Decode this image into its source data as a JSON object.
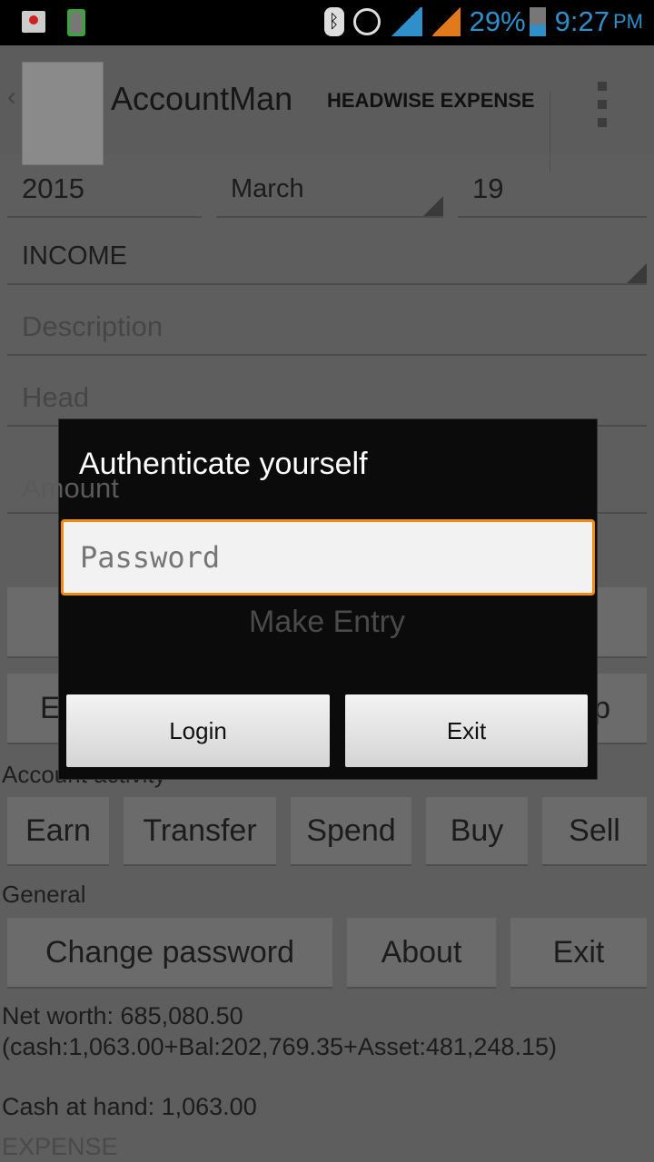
{
  "status_bar": {
    "battery": "29%",
    "time": "9:27",
    "ampm": "PM",
    "accent": "#2f8fc9"
  },
  "action_bar": {
    "title": "AccountMan",
    "action": "HEADWISE EXPENSE"
  },
  "form": {
    "year": "2015",
    "month": "March",
    "day": "19",
    "type": "INCOME",
    "description_hint": "Description",
    "head_hint": "Head",
    "amount_hint": "Amount",
    "make_entry": "Make Entry",
    "hidden_left": "E",
    "hidden_right": "p"
  },
  "account_activity": {
    "label": "Account activity",
    "buttons": [
      "Earn",
      "Transfer",
      "Spend",
      "Buy",
      "Sell"
    ]
  },
  "general": {
    "label": "General",
    "buttons": [
      "Change password",
      "About",
      "Exit"
    ]
  },
  "summary": {
    "net_worth": "Net worth: 685,080.50",
    "breakdown": "(cash:1,063.00+Bal:202,769.35+Asset:481,248.15)",
    "cash_at_hand": "Cash at hand: 1,063.00",
    "next_section": "EXPENSE"
  },
  "dialog": {
    "title": "Authenticate yourself",
    "password_placeholder": "Password",
    "login": "Login",
    "exit": "Exit",
    "focus_color": "#f08a13"
  }
}
